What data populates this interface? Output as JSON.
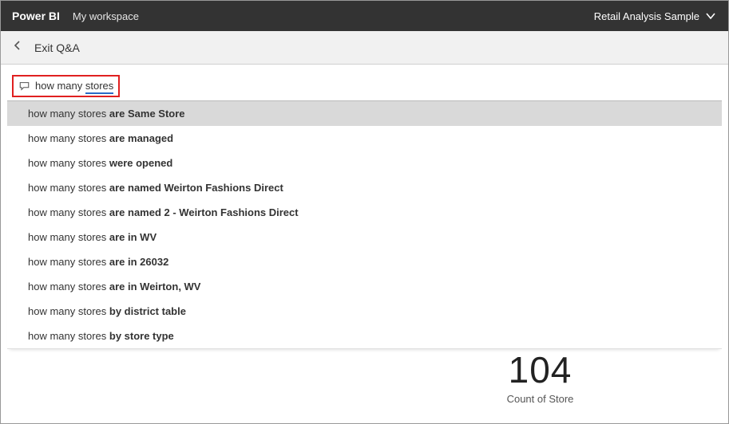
{
  "header": {
    "brand": "Power BI",
    "workspace": "My workspace",
    "reportName": "Retail Analysis Sample"
  },
  "subbar": {
    "exit_label": "Exit Q&A"
  },
  "qna": {
    "prefix": "how many ",
    "term": "stores"
  },
  "suggestions": [
    {
      "prefix": "how many stores ",
      "bold": "are Same Store"
    },
    {
      "prefix": "how many stores ",
      "bold": "are managed"
    },
    {
      "prefix": "how many stores ",
      "bold": "were opened"
    },
    {
      "prefix": "how many stores ",
      "bold": "are named Weirton Fashions Direct"
    },
    {
      "prefix": "how many stores ",
      "bold": "are named 2 - Weirton Fashions Direct"
    },
    {
      "prefix": "how many stores ",
      "bold": "are in WV"
    },
    {
      "prefix": "how many stores ",
      "bold": "are in 26032"
    },
    {
      "prefix": "how many stores ",
      "bold": "are in Weirton, WV"
    },
    {
      "prefix": "how many stores ",
      "bold": "by district table"
    },
    {
      "prefix": "how many stores ",
      "bold": "by store type"
    }
  ],
  "result": {
    "value": "104",
    "label": "Count of Store"
  }
}
